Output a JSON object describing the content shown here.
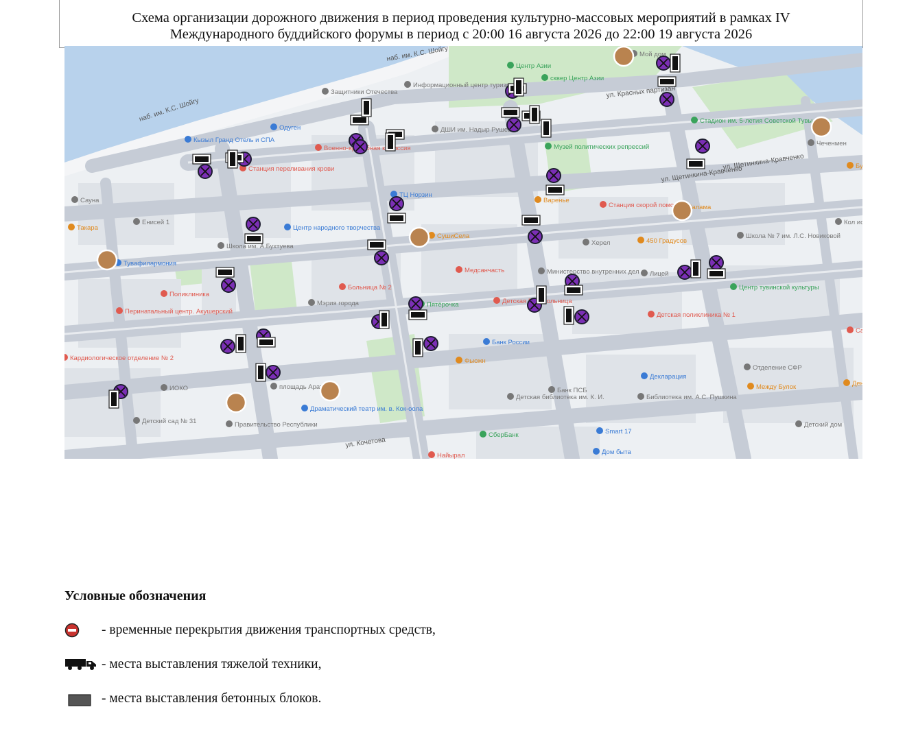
{
  "title": {
    "line1": "Схема организации дорожного движения в период проведения культурно-массовых мероприятий в рамках IV",
    "line2": "Международного буддийского форумы в период с 20:00 16 августа 2026 до 22:00 19 августа 2026"
  },
  "map": {
    "colors": {
      "water": "#b8d2ec",
      "park": "#cfe8c8",
      "road": "#c9cfd8",
      "block": "#dfe3e8",
      "restriction_fill": "#7b2fb5",
      "restriction_ring": "#1c1c2e",
      "poi_blue": "#3a7bd5",
      "poi_red": "#e05a4f",
      "poi_orange": "#e08a1e",
      "poi_green": "#3aa35b"
    },
    "street_labels": [
      "наб. им. К.С. Шойгу",
      "наб. им. К.С. Шойгу",
      "ул. Красных партизан",
      "ул. Щетинкина-Кравченко",
      "ул. Щетинкина-Кравченко",
      "ул. Кочетова"
    ],
    "pois": [
      {
        "label": "Центр Азии",
        "color": "green"
      },
      {
        "label": "сквер Центр Азии",
        "color": "green"
      },
      {
        "label": "Мой дом",
        "color": "gray"
      },
      {
        "label": "Информационный центр туризма",
        "color": "gray"
      },
      {
        "label": "Защитники Отечества",
        "color": "gray"
      },
      {
        "label": "Одуген",
        "color": "blue"
      },
      {
        "label": "Кызыл Гранд Отель и СПА",
        "color": "blue"
      },
      {
        "label": "ДШИ им. Надыр Рушевой",
        "color": "gray"
      },
      {
        "label": "Военно-врачебная комиссия",
        "color": "red"
      },
      {
        "label": "Станция переливания крови",
        "color": "red"
      },
      {
        "label": "Музей политических репрессий",
        "color": "green"
      },
      {
        "label": "Стадион им. 5-летия Советской Тувы",
        "color": "green"
      },
      {
        "label": "Чеченмен",
        "color": "gray"
      },
      {
        "label": "ТЦ Норзин",
        "color": "blue"
      },
      {
        "label": "Варенье",
        "color": "orange"
      },
      {
        "label": "Станция скорой помощи",
        "color": "red"
      },
      {
        "label": "Чалама",
        "color": "orange"
      },
      {
        "label": "Сауна",
        "color": "gray"
      },
      {
        "label": "Такара",
        "color": "orange"
      },
      {
        "label": "Енисей 1",
        "color": "gray"
      },
      {
        "label": "Центр народного творчества",
        "color": "blue"
      },
      {
        "label": "СушиСела",
        "color": "orange"
      },
      {
        "label": "Херел",
        "color": "gray"
      },
      {
        "label": "450 Градусов",
        "color": "orange"
      },
      {
        "label": "Школа № 7 им. Л.С. Новиковой",
        "color": "gray"
      },
      {
        "label": "Школа им. А.Бухтуева",
        "color": "gray"
      },
      {
        "label": "Тувафилармония",
        "color": "blue"
      },
      {
        "label": "Медсанчасть",
        "color": "red"
      },
      {
        "label": "Министерство внутренних дел",
        "color": "gray"
      },
      {
        "label": "Лицей",
        "color": "gray"
      },
      {
        "label": "Центр тувинской культуры",
        "color": "green"
      },
      {
        "label": "Поликлиника",
        "color": "red"
      },
      {
        "label": "Больница № 2",
        "color": "red"
      },
      {
        "label": "Перинатальный центр. Акушерский",
        "color": "red"
      },
      {
        "label": "Мэрия города",
        "color": "gray"
      },
      {
        "label": "Пятёрочка",
        "color": "green"
      },
      {
        "label": "Детская Психбольница",
        "color": "red"
      },
      {
        "label": "Детская поликлиника № 1",
        "color": "red"
      },
      {
        "label": "Банк России",
        "color": "blue"
      },
      {
        "label": "Фьюжн",
        "color": "orange"
      },
      {
        "label": "Отделение СФР",
        "color": "gray"
      },
      {
        "label": "Кардиологическое отделение № 2",
        "color": "red"
      },
      {
        "label": "ИОКО",
        "color": "gray"
      },
      {
        "label": "Декларация",
        "color": "blue"
      },
      {
        "label": "Детский сад № 31",
        "color": "gray"
      },
      {
        "label": "Правительство Республики",
        "color": "gray"
      },
      {
        "label": "площадь Арата",
        "color": "gray"
      },
      {
        "label": "Драматический театр им. в. Кок-оола",
        "color": "blue"
      },
      {
        "label": "Банк ПСБ",
        "color": "gray"
      },
      {
        "label": "Библиотека им. А.С. Пушкина",
        "color": "gray"
      },
      {
        "label": "Между Булок",
        "color": "orange"
      },
      {
        "label": "Детский дом",
        "color": "gray"
      },
      {
        "label": "Детская библиотека им. К. И.",
        "color": "gray"
      },
      {
        "label": "СберБанк",
        "color": "green"
      },
      {
        "label": "Smart 17",
        "color": "blue"
      },
      {
        "label": "Дом быта",
        "color": "blue"
      },
      {
        "label": "Найырал",
        "color": "red"
      },
      {
        "label": "Дентал",
        "color": "orange"
      },
      {
        "label": "Бу",
        "color": "orange"
      },
      {
        "label": "Кол искус Чур",
        "color": "gray"
      },
      {
        "label": "Cas",
        "color": "red"
      }
    ]
  },
  "legend": {
    "title": "Условные обозначения",
    "items": [
      {
        "icon": "no-entry-icon",
        "text": "- временные перекрытия движения транспортных средств,"
      },
      {
        "icon": "truck-icon",
        "text": "- места выставления тяжелой техники,"
      },
      {
        "icon": "concrete-block-icon",
        "text": "- места выставления бетонных блоков."
      }
    ]
  }
}
